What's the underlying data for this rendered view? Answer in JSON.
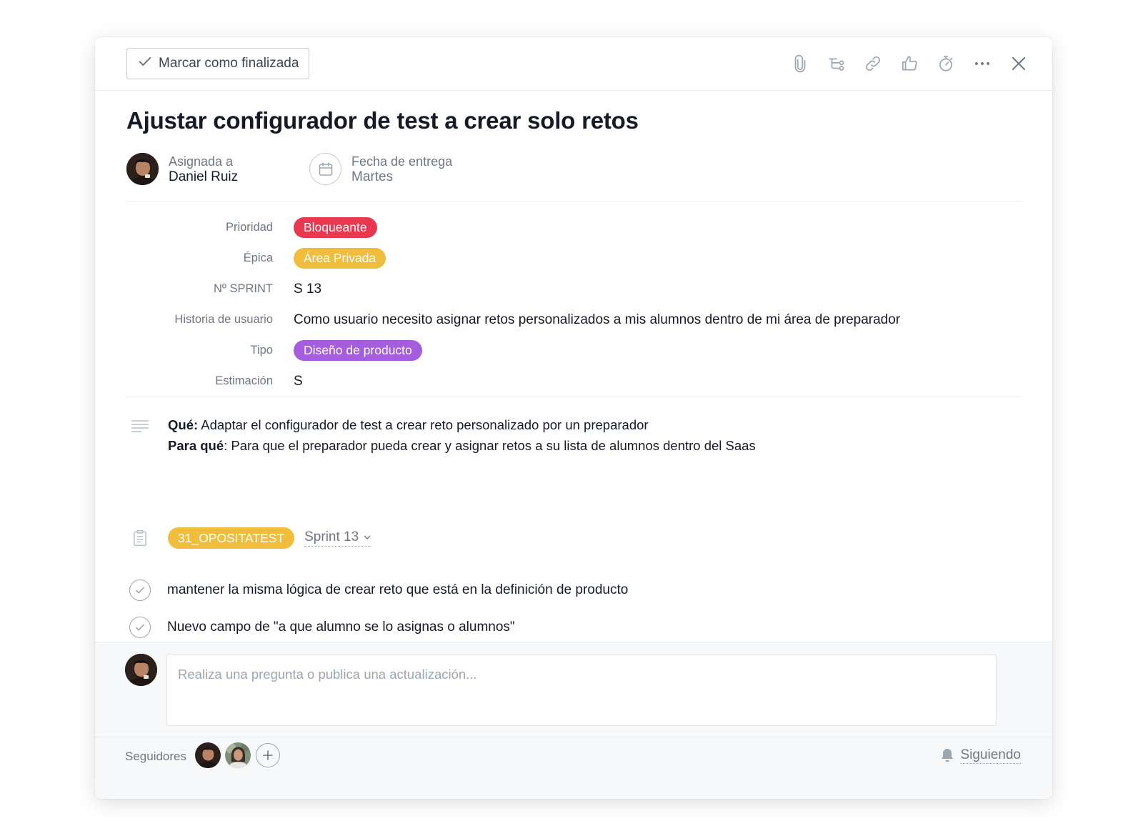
{
  "toolbar": {
    "complete_label": "Marcar como finalizada",
    "icons": [
      "attachment-icon",
      "subtask-icon",
      "link-icon",
      "like-icon",
      "timer-icon",
      "more-icon",
      "close-icon"
    ]
  },
  "task": {
    "title": "Ajustar configurador de test a crear solo retos",
    "assignee_label": "Asignada a",
    "assignee_name": "Daniel Ruiz",
    "due_label": "Fecha de entrega",
    "due_value": "Martes"
  },
  "fields": {
    "priority": {
      "label": "Prioridad",
      "value": "Bloqueante",
      "color": "#e8384f"
    },
    "epic": {
      "label": "Épica",
      "value": "Área Privada",
      "color": "#f1bd3c"
    },
    "sprint": {
      "label": "Nº SPRINT",
      "value": "S 13"
    },
    "story": {
      "label": "Historia de usuario",
      "value": "Como usuario necesito asignar retos personalizados a mis alumnos dentro de mi área de preparador"
    },
    "type": {
      "label": "Tipo",
      "value": "Diseño de producto",
      "color": "#a45ddd"
    },
    "estimate": {
      "label": "Estimación",
      "value": "S"
    }
  },
  "description": {
    "what_label": "Qué:",
    "what_text": " Adaptar el configurador de test a crear reto personalizado por un preparador",
    "why_label": "Para qué",
    "why_text": ": Para que el preparador pueda crear y asignar retos a su lista de alumnos dentro del Saas"
  },
  "project": {
    "name": "31_OPOSITATEST",
    "color": "#f1bd3c",
    "section": "Sprint 13"
  },
  "subtasks": [
    {
      "text": "mantener la misma lógica de crear reto que está en la definición de producto"
    },
    {
      "text": "Nuevo campo de \"a que alumno se lo asignas o alumnos\""
    }
  ],
  "comment": {
    "placeholder": "Realiza una pregunta o publica una actualización..."
  },
  "followers": {
    "label": "Seguidores",
    "following_label": "Siguiendo"
  }
}
